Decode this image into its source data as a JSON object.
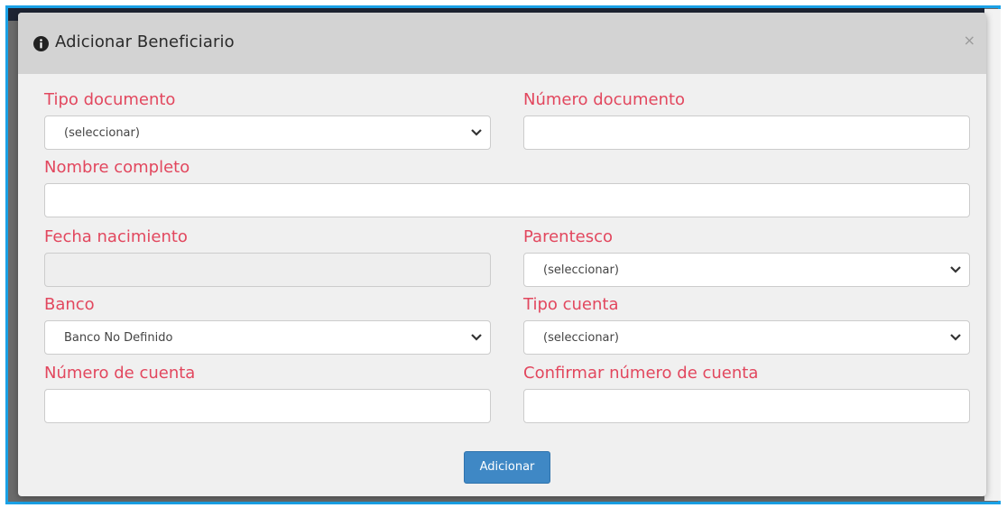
{
  "modal": {
    "title": "Adicionar Beneficiario",
    "close_label": "×"
  },
  "form": {
    "tipo_documento": {
      "label": "Tipo documento",
      "value": "(seleccionar)"
    },
    "numero_documento": {
      "label": "Número documento",
      "value": ""
    },
    "nombre_completo": {
      "label": "Nombre completo",
      "value": ""
    },
    "fecha_nacimiento": {
      "label": "Fecha nacimiento",
      "value": ""
    },
    "parentesco": {
      "label": "Parentesco",
      "value": "(seleccionar)"
    },
    "banco": {
      "label": "Banco",
      "value": "Banco No Definido"
    },
    "tipo_cuenta": {
      "label": "Tipo cuenta",
      "value": "(seleccionar)"
    },
    "numero_cuenta": {
      "label": "Número de cuenta",
      "value": ""
    },
    "confirmar_numero_cuenta": {
      "label": "Confirmar número de cuenta",
      "value": ""
    }
  },
  "actions": {
    "add_label": "Adicionar"
  },
  "colors": {
    "label": "#e2475e",
    "button": "#3f88c5",
    "frame": "#1aa1e6",
    "header": "#d3d3d3"
  },
  "icons": {
    "header": "info-circle-icon",
    "select": "chevron-down-icon",
    "close": "close-icon"
  }
}
